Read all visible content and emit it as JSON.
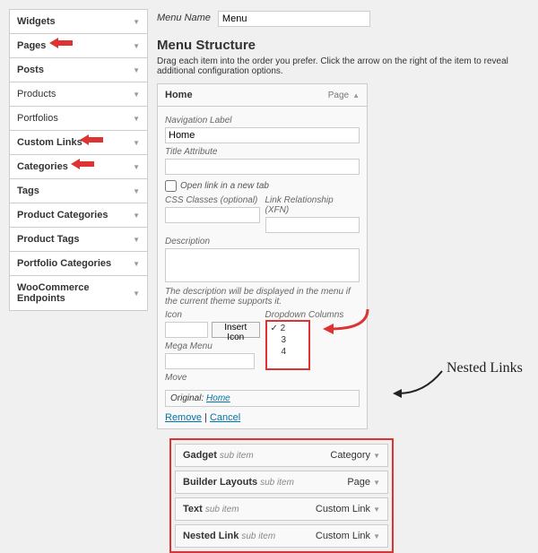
{
  "sidebar": {
    "items": [
      {
        "label": "Widgets",
        "bold": true
      },
      {
        "label": "Pages",
        "bold": true
      },
      {
        "label": "Posts",
        "bold": true
      },
      {
        "label": "Products",
        "bold": false
      },
      {
        "label": "Portfolios",
        "bold": false
      },
      {
        "label": "Custom Links",
        "bold": true
      },
      {
        "label": "Categories",
        "bold": true
      },
      {
        "label": "Tags",
        "bold": true
      },
      {
        "label": "Product Categories",
        "bold": true
      },
      {
        "label": "Product Tags",
        "bold": true
      },
      {
        "label": "Portfolio Categories",
        "bold": true
      },
      {
        "label": "WooCommerce Endpoints",
        "bold": true
      }
    ]
  },
  "menu_name_label": "Menu Name",
  "menu_name_value": "Menu",
  "structure_title": "Menu Structure",
  "structure_hint": "Drag each item into the order you prefer. Click the arrow on the right of the item to reveal additional configuration options.",
  "expanded": {
    "title": "Home",
    "type": "Page",
    "nav_label_lbl": "Navigation Label",
    "nav_label_val": "Home",
    "title_attr_lbl": "Title Attribute",
    "open_new_tab": "Open link in a new tab",
    "css_lbl": "CSS Classes (optional)",
    "xfn_lbl": "Link Relationship (XFN)",
    "desc_lbl": "Description",
    "desc_hint": "The description will be displayed in the menu if the current theme supports it.",
    "icon_lbl": "Icon",
    "insert_icon_btn": "Insert Icon",
    "dropdown_lbl": "Dropdown Columns",
    "dropdown_opts": [
      "2",
      "3",
      "4"
    ],
    "mega_lbl": "Mega Menu",
    "move_lbl": "Move",
    "original_prefix": "Original:",
    "original_link": "Home",
    "remove": "Remove",
    "cancel": "Cancel"
  },
  "nested_label": "Nested Links",
  "nested": [
    {
      "title": "Gadget",
      "type": "Category"
    },
    {
      "title": "Builder Layouts",
      "type": "Page"
    },
    {
      "title": "Text",
      "type": "Custom Link"
    },
    {
      "title": "Nested Link",
      "type": "Custom Link"
    }
  ],
  "sub_item_tag": "sub item"
}
